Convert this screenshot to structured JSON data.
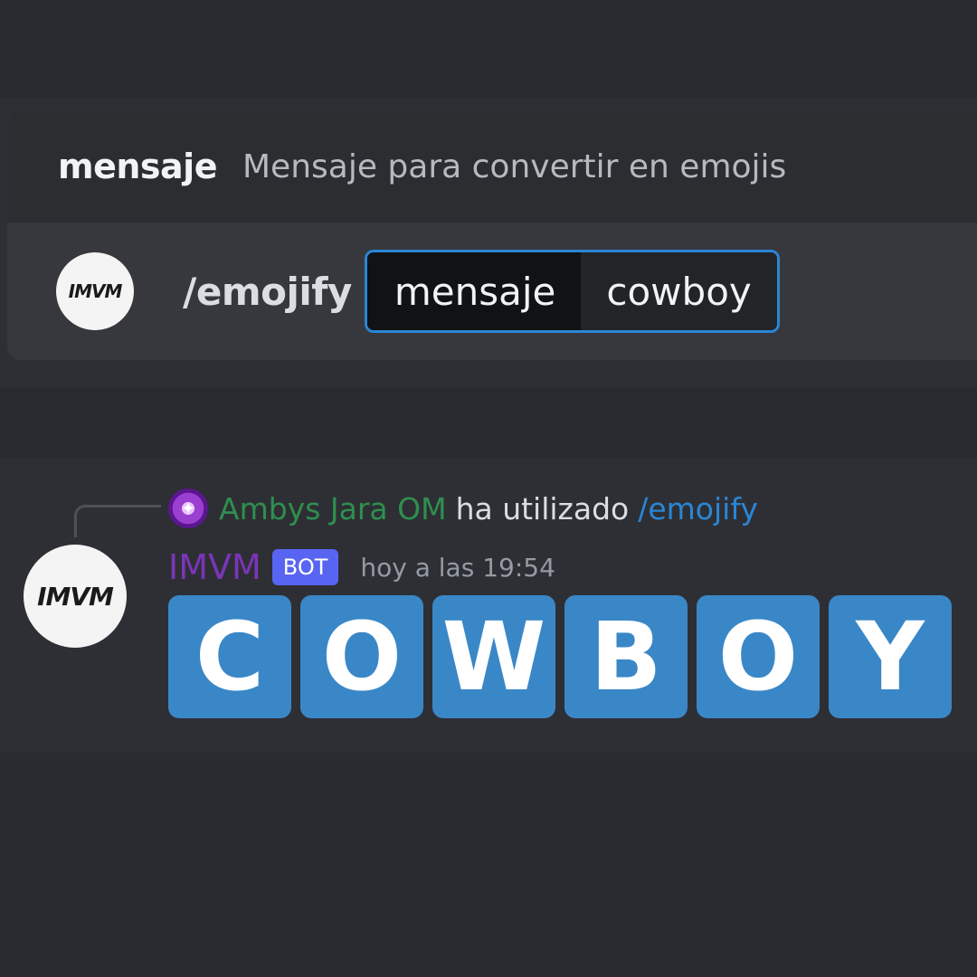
{
  "command_panel": {
    "option_name": "mensaje",
    "option_description": "Mensaje para convertir en emojis",
    "bot_logo_text": "IMVM",
    "command": "/emojify",
    "param_key": "mensaje",
    "param_value": "cowboy"
  },
  "message": {
    "reply": {
      "user": "Ambys Jara OM",
      "text": "ha utilizado",
      "command": "/emojify"
    },
    "bot_logo_text": "IMVM",
    "author": "IMVM",
    "badge": "BOT",
    "timestamp": "hoy a las 19:54",
    "emoji_letters": [
      "C",
      "O",
      "W",
      "B",
      "O",
      "Y"
    ]
  },
  "colors": {
    "background": "#2a2b30",
    "accent_blue": "#2a86d5",
    "emoji_tile": "#3a87c7",
    "bot_badge": "#5865f2",
    "author": "#7a35b8",
    "reply_user": "#2f8f4e"
  },
  "icons": {
    "bot_avatar": "imvm-logo-icon",
    "reply_avatar": "user-avatar-icon"
  }
}
